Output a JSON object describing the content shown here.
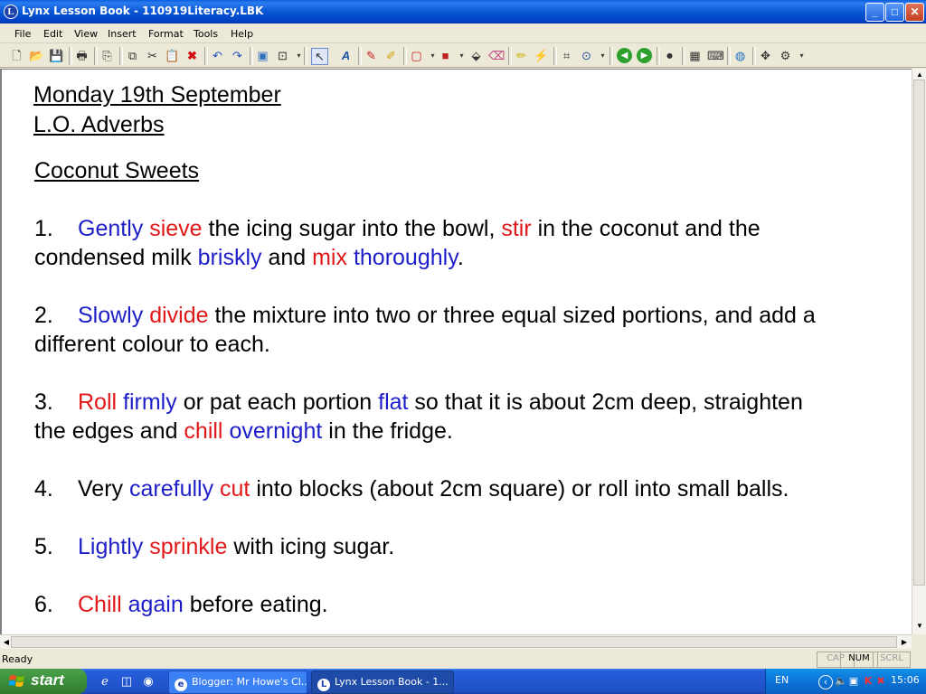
{
  "window": {
    "title": "Lynx Lesson Book - 110919Literacy.LBK",
    "app_icon_glyph": "L",
    "minimize": "_",
    "maximize": "□",
    "close": "✕"
  },
  "menu": [
    "File",
    "Edit",
    "View",
    "Insert",
    "Format",
    "Tools",
    "Help"
  ],
  "toolbar_icons": [
    "new-icon",
    "open-icon",
    "save-icon",
    "print-icon",
    "page-icon",
    "copy-icon",
    "cut-icon",
    "paste-icon",
    "delete-icon",
    "undo-icon",
    "redo-icon",
    "image-icon",
    "preview-icon",
    "select-arrow-icon",
    "text-icon",
    "pen-icon",
    "highlighter-icon",
    "shape-icon",
    "fill-icon",
    "bucket-icon",
    "eraser-icon",
    "marker-icon",
    "laser-icon",
    "crop-icon",
    "lasso-icon",
    "back-icon",
    "forward-icon",
    "record-icon",
    "calculator-icon",
    "keyboard-icon",
    "globe-icon",
    "move-icon",
    "settings-icon"
  ],
  "colors": {
    "adverb": "#1e1ec8",
    "verb": "#e01818",
    "text": "#000000"
  },
  "document": {
    "date": "Monday 19th September",
    "objective": "L.O. Adverbs",
    "heading": "Coconut Sweets",
    "steps": [
      {
        "number": "1.",
        "lines": [
          [
            {
              "t": "Gently",
              "c": "adverb"
            },
            {
              "t": " "
            },
            {
              "t": "sieve",
              "c": "verb"
            },
            {
              "t": " the icing sugar into the bowl, "
            },
            {
              "t": "stir",
              "c": "verb"
            },
            {
              "t": " in the coconut and the"
            }
          ],
          [
            {
              "t": "condensed milk "
            },
            {
              "t": "briskly",
              "c": "adverb"
            },
            {
              "t": " and "
            },
            {
              "t": "mix",
              "c": "verb"
            },
            {
              "t": " "
            },
            {
              "t": "thoroughly",
              "c": "adverb"
            },
            {
              "t": "."
            }
          ]
        ]
      },
      {
        "number": "2.",
        "lines": [
          [
            {
              "t": "Slowly",
              "c": "adverb"
            },
            {
              "t": " "
            },
            {
              "t": "divide",
              "c": "verb"
            },
            {
              "t": " the mixture into two or three equal sized portions, and add a"
            }
          ],
          [
            {
              "t": "different colour to each."
            }
          ]
        ]
      },
      {
        "number": "3.",
        "lines": [
          [
            {
              "t": "Roll",
              "c": "verb"
            },
            {
              "t": " "
            },
            {
              "t": "firmly",
              "c": "adverb"
            },
            {
              "t": " or pat each portion "
            },
            {
              "t": "flat",
              "c": "adverb"
            },
            {
              "t": " so that it is about 2cm deep, straighten"
            }
          ],
          [
            {
              "t": "the edges and "
            },
            {
              "t": "chill",
              "c": "verb"
            },
            {
              "t": " "
            },
            {
              "t": "overnight",
              "c": "adverb"
            },
            {
              "t": " in the fridge."
            }
          ]
        ]
      },
      {
        "number": "4.",
        "lines": [
          [
            {
              "t": "Very "
            },
            {
              "t": "carefully",
              "c": "adverb"
            },
            {
              "t": " "
            },
            {
              "t": "cut",
              "c": "verb"
            },
            {
              "t": " into blocks (about 2cm square) or roll into small balls."
            }
          ]
        ]
      },
      {
        "number": "5.",
        "lines": [
          [
            {
              "t": "Lightly",
              "c": "adverb"
            },
            {
              "t": " "
            },
            {
              "t": "sprinkle",
              "c": "verb"
            },
            {
              "t": " with icing sugar."
            }
          ]
        ]
      },
      {
        "number": "6.",
        "lines": [
          [
            {
              "t": "Chill",
              "c": "verb"
            },
            {
              "t": " "
            },
            {
              "t": "again",
              "c": "adverb"
            },
            {
              "t": " before eating."
            }
          ]
        ]
      }
    ]
  },
  "status": {
    "text": "Ready",
    "indicators": [
      {
        "label": "CAP",
        "on": false
      },
      {
        "label": "NUM",
        "on": true
      },
      {
        "label": "SCRL",
        "on": false
      }
    ]
  },
  "taskbar": {
    "start": "start",
    "tasks": [
      {
        "label": "Blogger: Mr Howe's Cl...",
        "active": false,
        "icon": "e"
      },
      {
        "label": "Lynx Lesson Book - 1...",
        "active": true,
        "icon": "L"
      }
    ],
    "tray": {
      "language": "EN",
      "clock": "15:06"
    }
  }
}
